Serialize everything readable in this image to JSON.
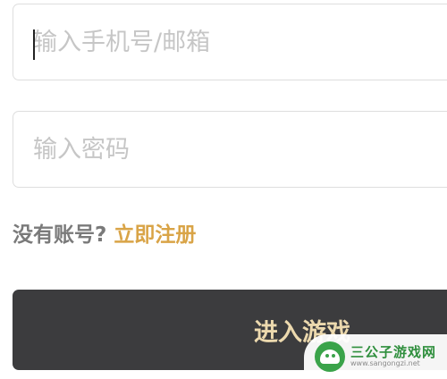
{
  "login": {
    "phone_placeholder": "输入手机号/邮箱",
    "password_placeholder": "输入密码",
    "no_account_text": "没有账号?",
    "register_link": "立即注册",
    "enter_button": "进入游戏"
  },
  "watermark": {
    "title": "三公子游戏网",
    "url": "www.sangongzi.net",
    "logo_color": "#3aa34a"
  },
  "colors": {
    "accent": "#d9a447",
    "button_bg": "#3c3c3e",
    "button_text": "#ecd9ae"
  }
}
